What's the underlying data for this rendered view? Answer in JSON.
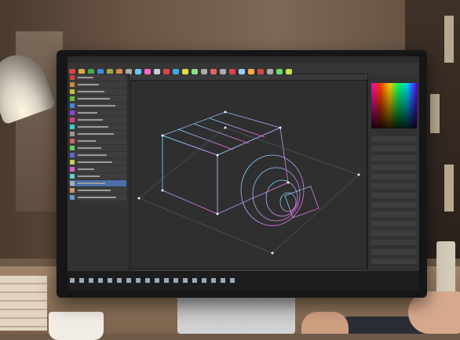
{
  "scene": {
    "description_tags": [
      "desk-lamp",
      "coffee-mug",
      "stack-of-books",
      "computer-monitor",
      "keyboard",
      "hand"
    ],
    "palette": {
      "wall": "#6b5646",
      "desk": "#a2856a",
      "screen_bg": "#3a3a3a",
      "wire_cyan": "#6fe4ff",
      "wire_magenta": "#ff5ce0",
      "accent_blue": "#4b6fa8"
    }
  },
  "app": {
    "left_panel_rows": 18,
    "left_panel_swatches": [
      "#c44",
      "#c84",
      "#cb4",
      "#6b4",
      "#48c",
      "#84c",
      "#c48",
      "#4cc",
      "#999",
      "#c66",
      "#6c6",
      "#66c",
      "#cc6",
      "#c6c",
      "#6cc",
      "#aaa",
      "#c96",
      "#69c"
    ],
    "right_panel_rows": 14,
    "toolbar_icon_colors": [
      "#d44",
      "#da4",
      "#4a4",
      "#48d",
      "#9a4",
      "#d84",
      "#aaa",
      "#6cf",
      "#f6c",
      "#ccc",
      "#d44",
      "#4ad",
      "#dd4",
      "#8d8",
      "#aaa",
      "#d66",
      "#aaa",
      "#d44",
      "#9cf",
      "#fa4",
      "#d44",
      "#aaa",
      "#6d6",
      "#cd4"
    ],
    "task_icons": 18
  }
}
